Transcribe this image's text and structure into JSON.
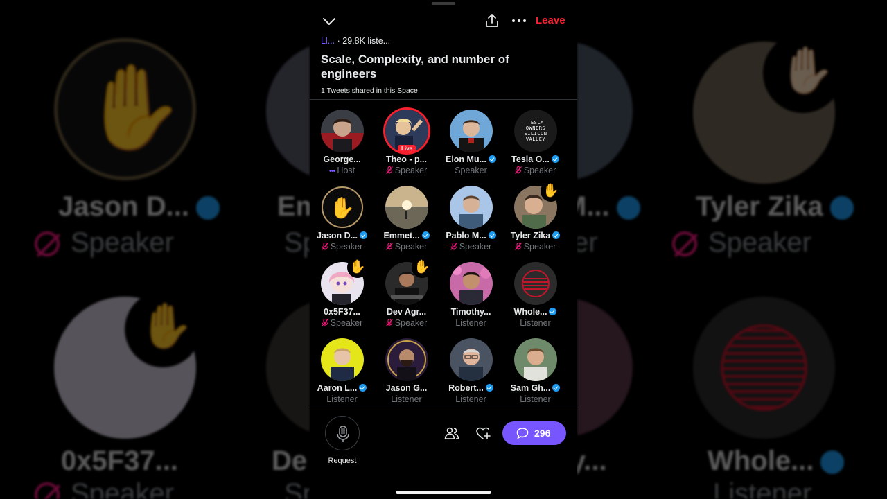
{
  "background": {
    "left": {
      "names": [
        "Jason D...",
        "Em",
        "0x5F37...",
        "De"
      ],
      "roles": [
        "Speaker",
        "Sp",
        "Speaker",
        "Sp"
      ]
    },
    "right": {
      "names": [
        "M...",
        "Tyler Zika",
        "y...",
        "Whole..."
      ],
      "roles": [
        "er",
        "Speaker",
        "Listener"
      ]
    }
  },
  "header": {
    "leave_label": "Leave",
    "prefix": "Ll...",
    "listeners": "· 29.8K liste...",
    "title": "Scale, Complexity, and number of engineers",
    "tweets_shared": "1 Tweets shared in this Space"
  },
  "participants": [
    {
      "name": "George...",
      "role": "Host",
      "verified": false,
      "icon": "host-dots",
      "avatar": "photo-george"
    },
    {
      "name": "Theo - p...",
      "role": "Speaker",
      "verified": false,
      "icon": "mic-off",
      "live": true,
      "live_label": "Live",
      "avatar": "photo-theo"
    },
    {
      "name": "Elon Mu...",
      "role": "Speaker",
      "verified": true,
      "icon": "none",
      "avatar": "photo-elon"
    },
    {
      "name": "Tesla O...",
      "role": "Speaker",
      "verified": true,
      "icon": "mic-off",
      "avatar": "logo-tesla-owners",
      "logo_text": [
        "TESLA",
        "OWNERS",
        "SILICON",
        "VALLEY"
      ]
    },
    {
      "name": "Jason D...",
      "role": "Speaker",
      "verified": true,
      "icon": "mic-off",
      "avatar": "hand-jason"
    },
    {
      "name": "Emmet...",
      "role": "Speaker",
      "verified": true,
      "icon": "mic-off",
      "avatar": "photo-emmet"
    },
    {
      "name": "Pablo M...",
      "role": "Speaker",
      "verified": true,
      "icon": "mic-off",
      "avatar": "photo-pablo"
    },
    {
      "name": "Tyler Zika",
      "role": "Speaker",
      "verified": true,
      "icon": "mic-off",
      "hand": true,
      "avatar": "photo-tyler"
    },
    {
      "name": "0x5F37...",
      "role": "Speaker",
      "verified": false,
      "icon": "mic-off",
      "hand": true,
      "avatar": "photo-anime"
    },
    {
      "name": "Dev Agr...",
      "role": "Speaker",
      "verified": false,
      "icon": "mic-off",
      "hand": true,
      "avatar": "photo-dev"
    },
    {
      "name": "Timothy...",
      "role": "Listener",
      "verified": false,
      "icon": "none",
      "avatar": "photo-timothy"
    },
    {
      "name": "Whole...",
      "role": "Listener",
      "verified": true,
      "icon": "none",
      "avatar": "logo-whole"
    },
    {
      "name": "Aaron L...",
      "role": "Listener",
      "verified": true,
      "icon": "none",
      "avatar": "photo-aaron"
    },
    {
      "name": "Jason G...",
      "role": "Listener",
      "verified": false,
      "icon": "none",
      "avatar": "photo-jasong"
    },
    {
      "name": "Robert...",
      "role": "Listener",
      "verified": true,
      "icon": "none",
      "avatar": "photo-robert"
    },
    {
      "name": "Sam Gh...",
      "role": "Listener",
      "verified": true,
      "icon": "none",
      "avatar": "photo-sam"
    }
  ],
  "footer": {
    "request_label": "Request",
    "comment_count": "296"
  },
  "colors": {
    "accent": "#7856ff",
    "leave": "#f4212e",
    "verified": "#1d9bf0",
    "mic_off": "#f91880"
  }
}
